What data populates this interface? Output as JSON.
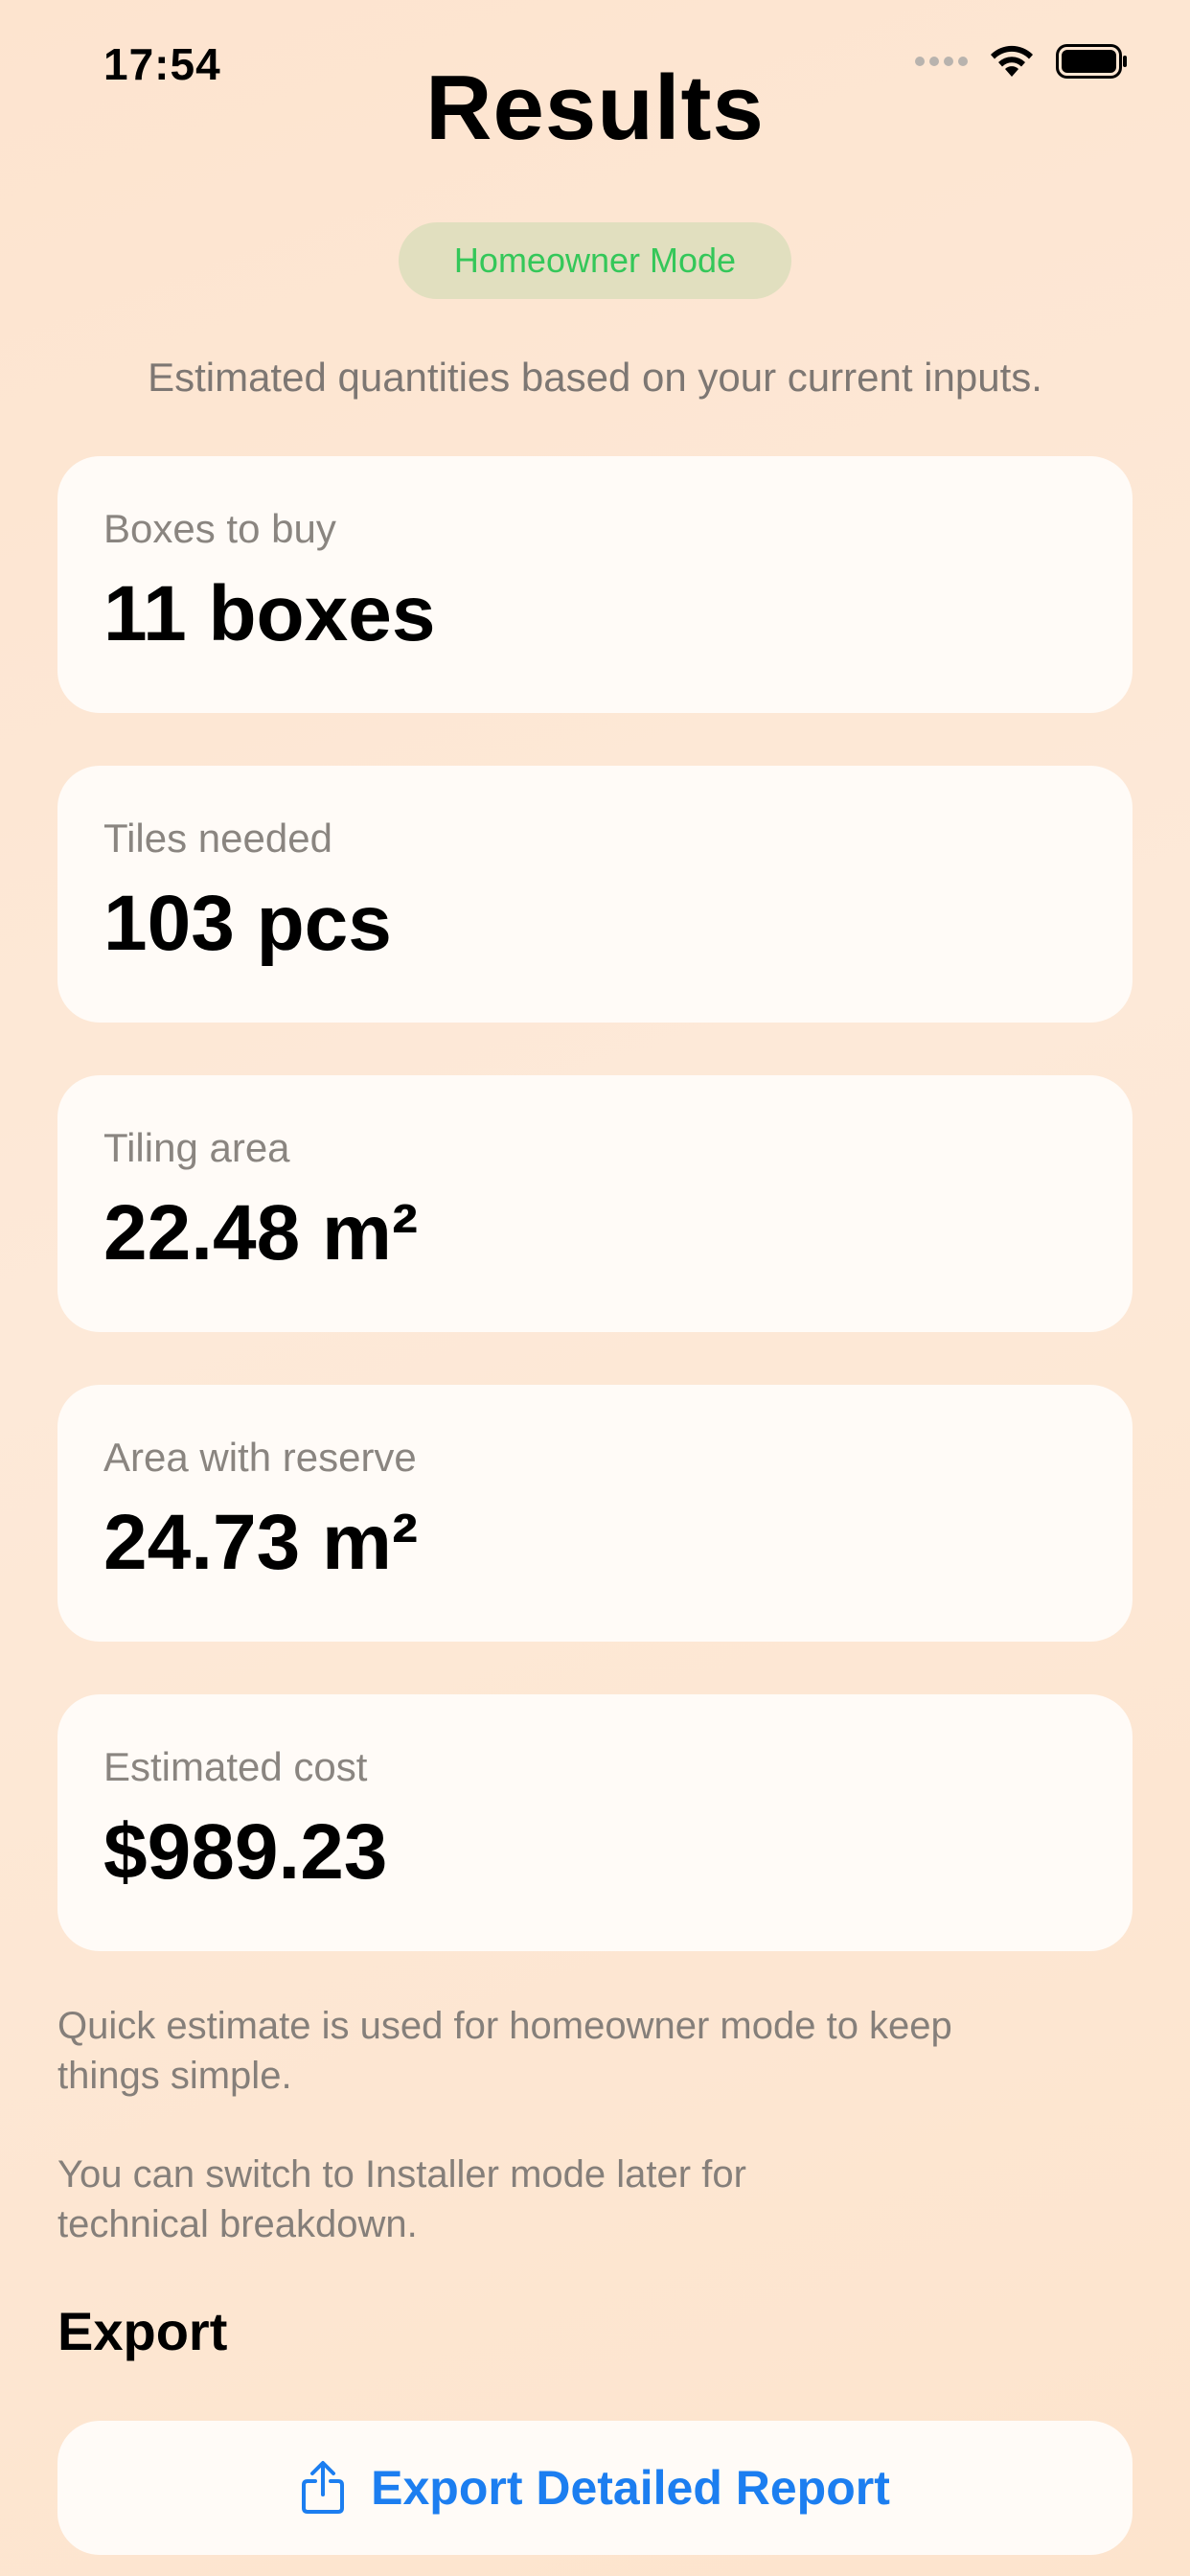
{
  "status_bar": {
    "time": "17:54"
  },
  "header": {
    "title": "Results"
  },
  "mode_badge": {
    "label": "Homeowner Mode",
    "color": "#34c759"
  },
  "subtitle": "Estimated quantities based on your current inputs.",
  "results": [
    {
      "label": "Boxes to buy",
      "value": "11 boxes"
    },
    {
      "label": "Tiles needed",
      "value": "103 pcs"
    },
    {
      "label": "Tiling area",
      "value": "22.48 m²"
    },
    {
      "label": "Area with reserve",
      "value": "24.73 m²"
    },
    {
      "label": "Estimated cost",
      "value": "$989.23"
    }
  ],
  "notes": {
    "line1a": "Quick estimate is used for homeowner mode to keep",
    "line1b": "things simple.",
    "line2a": "You can switch to Installer mode later for",
    "line2b": "technical breakdown."
  },
  "export": {
    "section_title": "Export",
    "button_label": "Export Detailed Report",
    "button_icon": "share-icon",
    "accent_color": "#1c7ef0"
  }
}
